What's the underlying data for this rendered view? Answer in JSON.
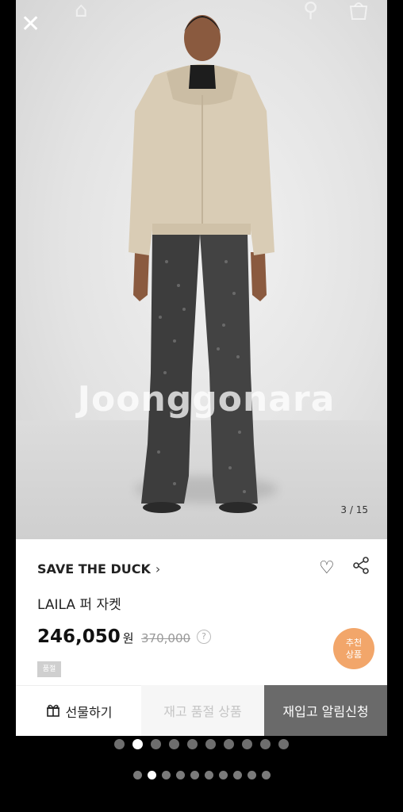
{
  "gallery": {
    "watermark": "Joonggonara",
    "counter": "3 / 15",
    "current_index": 3,
    "total": 15
  },
  "icons": {
    "close": "close-icon",
    "home": "home-icon",
    "search": "search-icon",
    "bag": "bag-icon",
    "heart": "heart-icon",
    "share": "share-icon",
    "gift": "gift-icon",
    "help": "question-icon"
  },
  "product": {
    "brand": "SAVE THE DUCK",
    "brand_chevron": "›",
    "name": "LAILA 퍼 자켓",
    "price": "246,050",
    "currency": "원",
    "original_price": "370,000",
    "help_glyph": "?",
    "status_badge": "품절",
    "recommend_line1": "추천",
    "recommend_line2": "상품"
  },
  "actions": {
    "gift": "선물하기",
    "soldout": "재고 품절 상품",
    "notify": "재입고 알림신청"
  },
  "colors": {
    "recommend_badge": "#f2a66a",
    "notify_button": "#6a6a6a",
    "soldout_text": "#c5c5c5"
  },
  "pager": {
    "large_dots": 10,
    "large_active": 1,
    "small_dots": 10,
    "small_active": 1
  }
}
